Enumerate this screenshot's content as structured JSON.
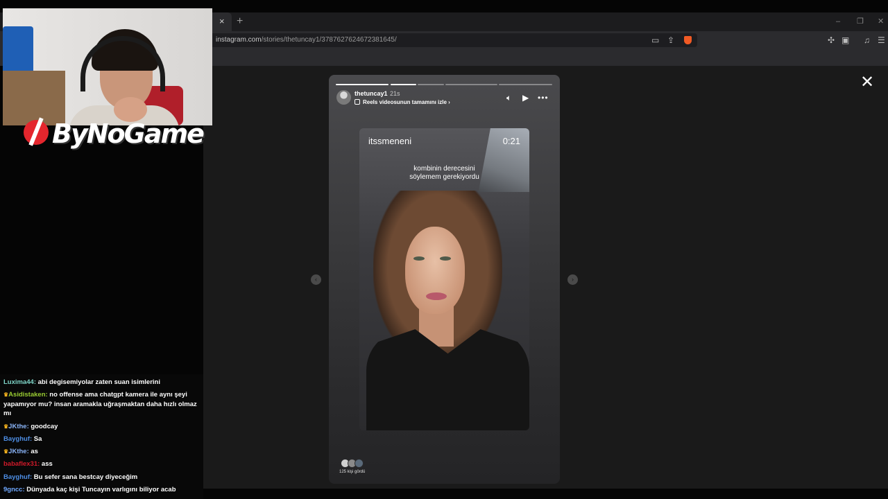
{
  "browser": {
    "tab_close": "×",
    "new_tab": "+",
    "window_controls": [
      "–",
      "❐",
      "✕"
    ],
    "url_host": "instagram.com",
    "url_path": "/stories/thetuncay1/3787627624672381645/",
    "toolbar_icons": [
      "cast-icon",
      "share-icon",
      "brave-shield-icon",
      "extensions-icon",
      "wallet-icon",
      "media-icon",
      "menu-icon"
    ]
  },
  "story": {
    "username": "thetuncay1",
    "time_ago": "21s",
    "reels_link": "Reels videosunun tamamını izle ›",
    "progress_segments": [
      1,
      1,
      0,
      0,
      0
    ],
    "reel_username": "itssmeneni",
    "reel_time": "0:21",
    "caption_line1": "kombinin derecesini",
    "caption_line2": "söylemem gerekiyordu",
    "viewers": "125 kişi gördü"
  },
  "overlay": {
    "logo": "ByNoGame"
  },
  "chat": [
    {
      "user": "Luxima44:",
      "text": " abi degisemiyolar zaten suan isimlerini",
      "color": "#7fd6c9",
      "crown": false
    },
    {
      "user": "Asidistaken:",
      "text": " no offense ama chatgpt kamera ile aynı şeyi yapamıyor mu? insan aramakla uğraşmaktan daha hızlı olmaz mı",
      "color": "#9acd32",
      "crown": true
    },
    {
      "user": "JKthe:",
      "text": " goodcay",
      "color": "#8ab4f8",
      "crown": true
    },
    {
      "user": "Bayghuf:",
      "text": " Sa",
      "color": "#4e8fe6",
      "crown": false
    },
    {
      "user": "JKthe:",
      "text": " as",
      "color": "#8ab4f8",
      "crown": true
    },
    {
      "user": "babaflex31:",
      "text": " ass",
      "color": "#d11a2a",
      "crown": false
    },
    {
      "user": "Bayghuf:",
      "text": " Bu sefer sana bestcay diyeceğim",
      "color": "#4e8fe6",
      "crown": false
    },
    {
      "user": "9gncc:",
      "text": " Dünyada kaç kişi Tuncayın varlıgını biliyor acab",
      "color": "#6fa8ff",
      "crown": false
    }
  ]
}
